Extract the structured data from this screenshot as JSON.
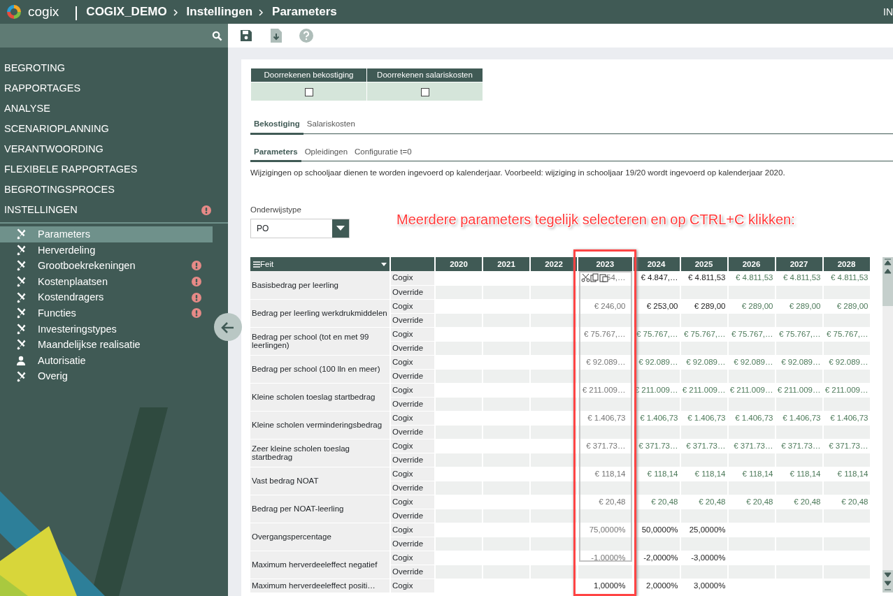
{
  "header": {
    "brand": "cogix",
    "breadcrumb": [
      "COGIX_DEMO",
      "Instellingen",
      "Parameters"
    ],
    "user": "IN"
  },
  "sidebar": {
    "sections": [
      {
        "label": "BEGROTING",
        "alert": false
      },
      {
        "label": "RAPPORTAGES",
        "alert": false
      },
      {
        "label": "ANALYSE",
        "alert": false
      },
      {
        "label": "SCENARIOPLANNING",
        "alert": false
      },
      {
        "label": "VERANTWOORDING",
        "alert": false
      },
      {
        "label": "FLEXIBELE RAPPORTAGES",
        "alert": false
      },
      {
        "label": "BEGROTINGSPROCES",
        "alert": false
      },
      {
        "label": "INSTELLINGEN",
        "alert": true,
        "children": [
          {
            "label": "Parameters",
            "kind": "tools",
            "selected": true,
            "alert": false
          },
          {
            "label": "Herverdeling",
            "kind": "tools",
            "selected": false,
            "alert": false
          },
          {
            "label": "Grootboekrekeningen",
            "kind": "tools",
            "selected": false,
            "alert": true
          },
          {
            "label": "Kostenplaatsen",
            "kind": "tools",
            "selected": false,
            "alert": true
          },
          {
            "label": "Kostendragers",
            "kind": "tools",
            "selected": false,
            "alert": true
          },
          {
            "label": "Functies",
            "kind": "tools",
            "selected": false,
            "alert": true
          },
          {
            "label": "Investeringstypes",
            "kind": "tools",
            "selected": false,
            "alert": false
          },
          {
            "label": "Maandelijkse realisatie",
            "kind": "tools",
            "selected": false,
            "alert": false
          },
          {
            "label": "Autorisatie",
            "kind": "user",
            "selected": false,
            "alert": false
          },
          {
            "label": "Overig",
            "kind": "tools",
            "selected": false,
            "alert": false
          }
        ]
      }
    ]
  },
  "recalc": [
    {
      "label": "Doorrekenen bekostiging",
      "checked": false
    },
    {
      "label": "Doorrekenen salariskosten",
      "checked": false
    }
  ],
  "tabs": [
    {
      "label": "Bekostiging",
      "selected": true
    },
    {
      "label": "Salariskosten",
      "selected": false
    }
  ],
  "subtabs": [
    {
      "label": "Parameters",
      "selected": true
    },
    {
      "label": "Opleidingen",
      "selected": false
    },
    {
      "label": "Configuratie t=0",
      "selected": false
    }
  ],
  "note": "Wijzigingen op schooljaar dienen te worden ingevoerd op kalenderjaar. Voorbeeld: wijziging in schooljaar 19/20 wordt ingevoerd op kalenderjaar 2020.",
  "filter": {
    "label": "Onderwijstype",
    "value": "PO"
  },
  "annotation": "Meerdere parameters tegelijk selecteren en op CTRL+C klikken:",
  "table": {
    "fact_header": "Feit",
    "columns": [
      "2020",
      "2021",
      "2022",
      "2023",
      "2024",
      "2025",
      "2026",
      "2027",
      "2028"
    ],
    "rows": [
      {
        "fact": "Basisbedrag per leerling",
        "sources": [
          {
            "label": "Cogix",
            "cells": [
              null,
              null,
              null,
              {
                "text": "54,…",
                "kind": "inherited",
                "selected": true
              },
              {
                "text": "€ 4.847,…",
                "kind": "manual",
                "selected": false
              },
              {
                "text": "€ 4.811,53",
                "kind": "manual",
                "selected": false
              },
              {
                "text": "€ 4.811,53",
                "kind": "inherited",
                "selected": false
              },
              {
                "text": "€ 4.811,53",
                "kind": "inherited",
                "selected": false
              },
              {
                "text": "€ 4.811,53",
                "kind": "inherited",
                "selected": false
              }
            ]
          },
          {
            "label": "Override"
          }
        ]
      },
      {
        "fact": "Bedrag per leerling werkdrukmiddelen",
        "sources": [
          {
            "label": "Cogix",
            "cells": [
              null,
              null,
              null,
              {
                "text": "€ 246,00",
                "kind": "inherited",
                "selected": true
              },
              {
                "text": "€ 253,00",
                "kind": "manual",
                "selected": false
              },
              {
                "text": "€ 289,00",
                "kind": "manual",
                "selected": false
              },
              {
                "text": "€ 289,00",
                "kind": "inherited",
                "selected": false
              },
              {
                "text": "€ 289,00",
                "kind": "inherited",
                "selected": false
              },
              {
                "text": "€ 289,00",
                "kind": "inherited",
                "selected": false
              }
            ]
          },
          {
            "label": "Override"
          }
        ]
      },
      {
        "fact": "Bedrag per school (tot en met 99 leerlingen)",
        "sources": [
          {
            "label": "Cogix",
            "cells": [
              null,
              null,
              null,
              {
                "text": "€ 75.767,…",
                "kind": "inherited",
                "selected": true
              },
              {
                "text": "€ 75.767,…",
                "kind": "inherited",
                "selected": false
              },
              {
                "text": "€ 75.767,…",
                "kind": "inherited",
                "selected": false
              },
              {
                "text": "€ 75.767,…",
                "kind": "inherited",
                "selected": false
              },
              {
                "text": "€ 75.767,…",
                "kind": "inherited",
                "selected": false
              },
              {
                "text": "€ 75.767,…",
                "kind": "inherited",
                "selected": false
              }
            ]
          },
          {
            "label": "Override"
          }
        ]
      },
      {
        "fact": "Bedrag per school (100 lln en meer)",
        "sources": [
          {
            "label": "Cogix",
            "cells": [
              null,
              null,
              null,
              {
                "text": "€ 92.089…",
                "kind": "inherited",
                "selected": true
              },
              {
                "text": "€ 92.089…",
                "kind": "inherited",
                "selected": false
              },
              {
                "text": "€ 92.089…",
                "kind": "inherited",
                "selected": false
              },
              {
                "text": "€ 92.089…",
                "kind": "inherited",
                "selected": false
              },
              {
                "text": "€ 92.089…",
                "kind": "inherited",
                "selected": false
              },
              {
                "text": "€ 92.089…",
                "kind": "inherited",
                "selected": false
              }
            ]
          },
          {
            "label": "Override"
          }
        ]
      },
      {
        "fact": "Kleine scholen toeslag startbedrag",
        "sources": [
          {
            "label": "Cogix",
            "cells": [
              null,
              null,
              null,
              {
                "text": "€ 211.009…",
                "kind": "inherited",
                "selected": true
              },
              {
                "text": "€ 211.009…",
                "kind": "inherited",
                "selected": false
              },
              {
                "text": "€ 211.009…",
                "kind": "inherited",
                "selected": false
              },
              {
                "text": "€ 211.009…",
                "kind": "inherited",
                "selected": false
              },
              {
                "text": "€ 211.009…",
                "kind": "inherited",
                "selected": false
              },
              {
                "text": "€ 211.009…",
                "kind": "inherited",
                "selected": false
              }
            ]
          },
          {
            "label": "Override"
          }
        ]
      },
      {
        "fact": "Kleine scholen verminderingsbedrag",
        "sources": [
          {
            "label": "Cogix",
            "cells": [
              null,
              null,
              null,
              {
                "text": "€ 1.406,73",
                "kind": "inherited",
                "selected": true
              },
              {
                "text": "€ 1.406,73",
                "kind": "inherited",
                "selected": false
              },
              {
                "text": "€ 1.406,73",
                "kind": "inherited",
                "selected": false
              },
              {
                "text": "€ 1.406,73",
                "kind": "inherited",
                "selected": false
              },
              {
                "text": "€ 1.406,73",
                "kind": "inherited",
                "selected": false
              },
              {
                "text": "€ 1.406,73",
                "kind": "inherited",
                "selected": false
              }
            ]
          },
          {
            "label": "Override"
          }
        ]
      },
      {
        "fact": "Zeer kleine scholen toeslag startbedrag",
        "sources": [
          {
            "label": "Cogix",
            "cells": [
              null,
              null,
              null,
              {
                "text": "€ 371.73…",
                "kind": "inherited",
                "selected": true
              },
              {
                "text": "€ 371.73…",
                "kind": "inherited",
                "selected": false
              },
              {
                "text": "€ 371.73…",
                "kind": "inherited",
                "selected": false
              },
              {
                "text": "€ 371.73…",
                "kind": "inherited",
                "selected": false
              },
              {
                "text": "€ 371.73…",
                "kind": "inherited",
                "selected": false
              },
              {
                "text": "€ 371.73…",
                "kind": "inherited",
                "selected": false
              }
            ]
          },
          {
            "label": "Override"
          }
        ]
      },
      {
        "fact": "Vast bedrag NOAT",
        "sources": [
          {
            "label": "Cogix",
            "cells": [
              null,
              null,
              null,
              {
                "text": "€ 118,14",
                "kind": "inherited",
                "selected": true
              },
              {
                "text": "€ 118,14",
                "kind": "inherited",
                "selected": false
              },
              {
                "text": "€ 118,14",
                "kind": "inherited",
                "selected": false
              },
              {
                "text": "€ 118,14",
                "kind": "inherited",
                "selected": false
              },
              {
                "text": "€ 118,14",
                "kind": "inherited",
                "selected": false
              },
              {
                "text": "€ 118,14",
                "kind": "inherited",
                "selected": false
              }
            ]
          },
          {
            "label": "Override"
          }
        ]
      },
      {
        "fact": "Bedrag per NOAT-leerling",
        "sources": [
          {
            "label": "Cogix",
            "cells": [
              null,
              null,
              null,
              {
                "text": "€ 20,48",
                "kind": "inherited",
                "selected": true
              },
              {
                "text": "€ 20,48",
                "kind": "inherited",
                "selected": false
              },
              {
                "text": "€ 20,48",
                "kind": "inherited",
                "selected": false
              },
              {
                "text": "€ 20,48",
                "kind": "inherited",
                "selected": false
              },
              {
                "text": "€ 20,48",
                "kind": "inherited",
                "selected": false
              },
              {
                "text": "€ 20,48",
                "kind": "inherited",
                "selected": false
              }
            ]
          },
          {
            "label": "Override"
          }
        ]
      },
      {
        "fact": "Overgangspercentage",
        "sources": [
          {
            "label": "Cogix",
            "cells": [
              null,
              null,
              null,
              {
                "text": "75,0000%",
                "kind": "manual",
                "selected": true
              },
              {
                "text": "50,0000%",
                "kind": "manual",
                "selected": false
              },
              {
                "text": "25,0000%",
                "kind": "manual",
                "selected": false
              },
              null,
              null,
              null
            ]
          },
          {
            "label": "Override"
          }
        ]
      },
      {
        "fact": "Maximum herverdeeleffect negatief",
        "sources": [
          {
            "label": "Cogix",
            "cells": [
              null,
              null,
              null,
              {
                "text": "-1,0000%",
                "kind": "manual",
                "selected": true
              },
              {
                "text": "-2,0000%",
                "kind": "manual",
                "selected": false
              },
              {
                "text": "-3,0000%",
                "kind": "manual",
                "selected": false
              },
              null,
              null,
              null
            ]
          },
          {
            "label": "Override"
          }
        ]
      },
      {
        "fact": "Maximum herverdeeleffect positi…",
        "sources": [
          {
            "label": "Cogix",
            "cells": [
              null,
              null,
              null,
              {
                "text": "1,0000%",
                "kind": "manual",
                "selected": false
              },
              {
                "text": "2,0000%",
                "kind": "manual",
                "selected": false
              },
              {
                "text": "3,0000%",
                "kind": "manual",
                "selected": false
              },
              null,
              null,
              null
            ]
          }
        ]
      }
    ]
  }
}
